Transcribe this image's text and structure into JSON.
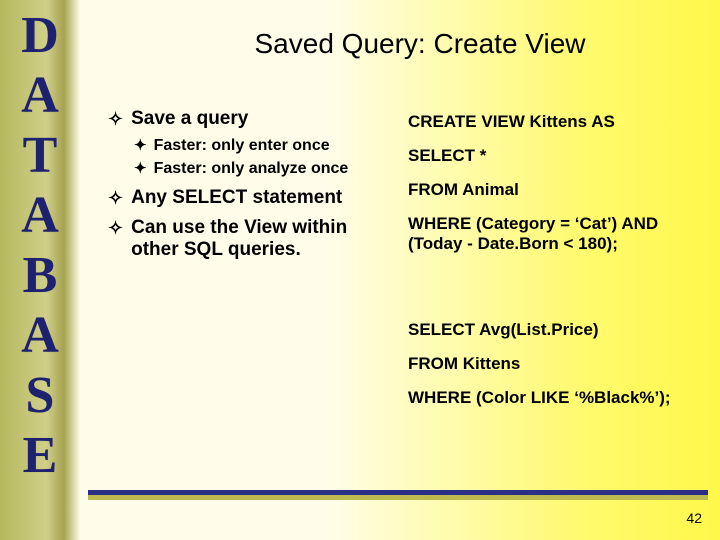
{
  "sidebar": {
    "letters": [
      "D",
      "A",
      "T",
      "A",
      "B",
      "A",
      "S",
      "E"
    ]
  },
  "title": "Saved Query: Create View",
  "bullets": {
    "b1": "Save a query",
    "b1a": "Faster: only enter once",
    "b1b": "Faster: only analyze once",
    "b2": "Any SELECT statement",
    "b3": "Can use the View within other SQL queries."
  },
  "sql_block1": {
    "l1": "CREATE VIEW Kittens AS",
    "l2": "SELECT *",
    "l3": "FROM Animal",
    "l4": "WHERE (Category = ‘Cat’) AND (Today - Date.Born < 180);"
  },
  "sql_block2": {
    "l1": "SELECT Avg(List.Price)",
    "l2": "FROM Kittens",
    "l3": "WHERE (Color LIKE ‘%Black%’);"
  },
  "page_number": "42",
  "glyphs": {
    "diamond": "✦",
    "cross": "✦"
  }
}
